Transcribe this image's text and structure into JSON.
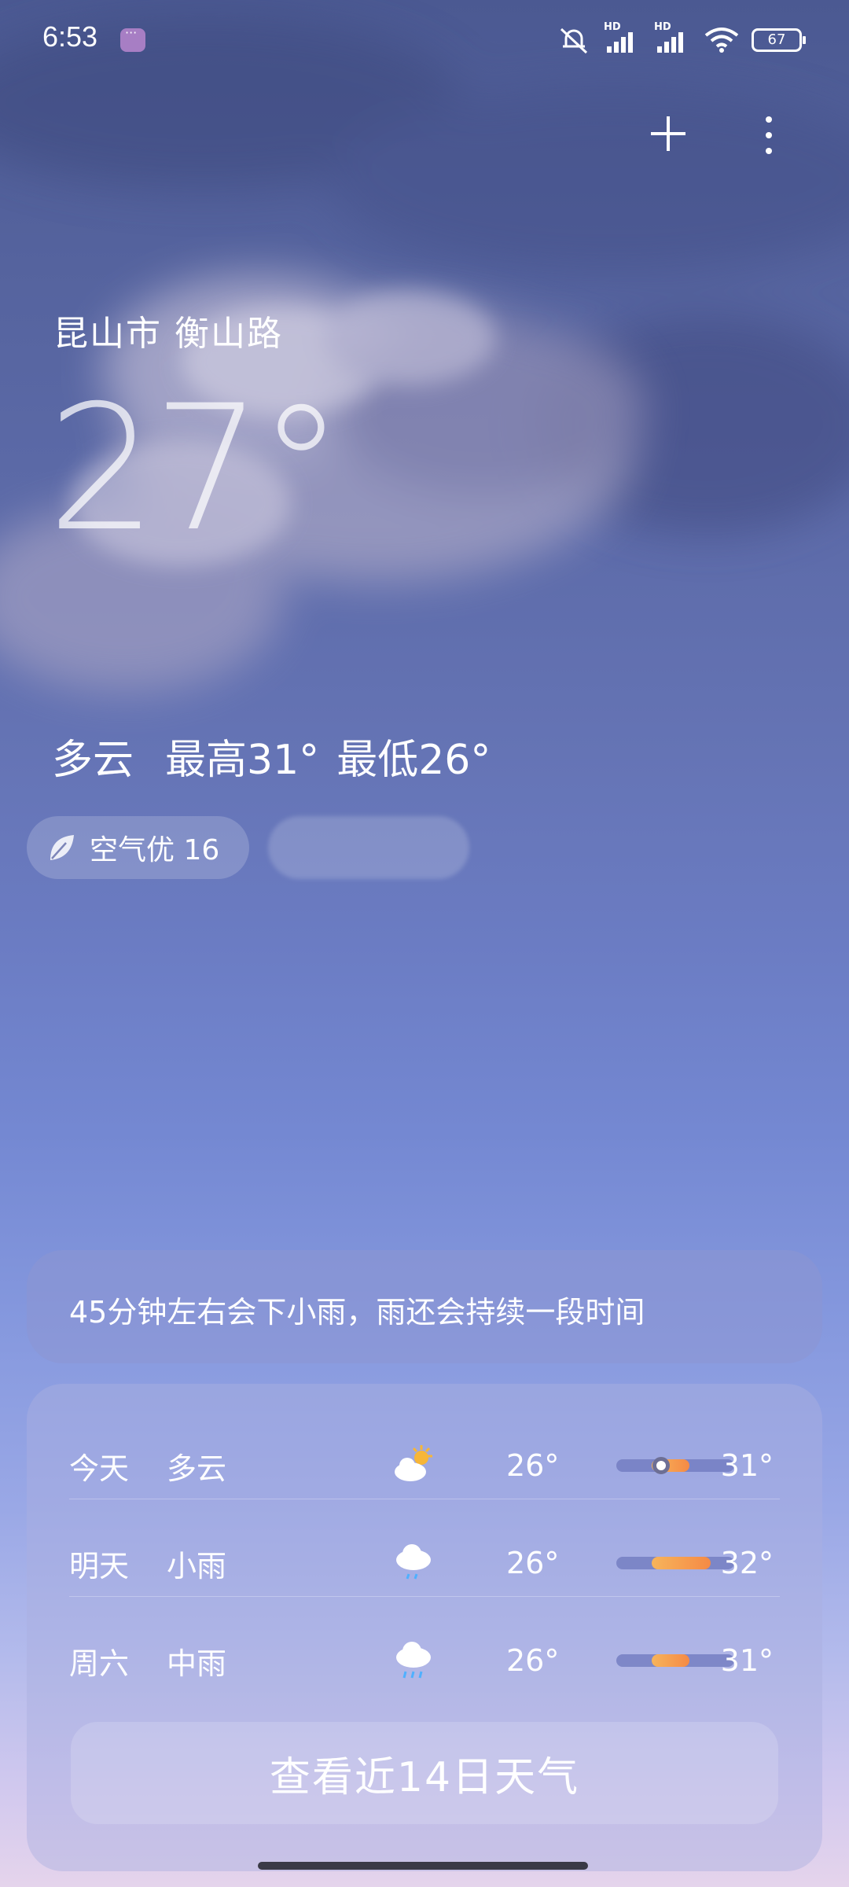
{
  "status_bar": {
    "time": "6:53",
    "signal_1_label": "HD",
    "signal_2_label": "HD",
    "battery": "67",
    "icons": [
      "chat-notification-icon",
      "silent-icon",
      "signal-icon",
      "wifi-icon",
      "battery-icon"
    ]
  },
  "header": {
    "add_icon": "plus-icon",
    "more_icon": "more-vertical-icon"
  },
  "current": {
    "location": "昆山市 衡山路",
    "temperature": "27°",
    "condition": "多云",
    "high": "最高31°",
    "low": "最低26°",
    "air_quality": "空气优 16"
  },
  "alert": {
    "text": "45分钟左右会下小雨，雨还会持续一段时间"
  },
  "forecast": {
    "days": [
      {
        "day": "今天",
        "condition": "多云",
        "icon": "partly-cloudy-icon",
        "low": "26°",
        "high": "31°",
        "bar_start": 0.3,
        "bar_end": 0.62,
        "current_marker": 0.38
      },
      {
        "day": "明天",
        "condition": "小雨",
        "icon": "light-rain-icon",
        "low": "26°",
        "high": "32°",
        "bar_start": 0.3,
        "bar_end": 0.8
      },
      {
        "day": "周六",
        "condition": "中雨",
        "icon": "moderate-rain-icon",
        "low": "26°",
        "high": "31°",
        "bar_start": 0.3,
        "bar_end": 0.62
      }
    ],
    "button_label": "查看近14日天气"
  },
  "colors": {
    "sky_top": "#4b5992",
    "sky_bottom": "#e5d4ec",
    "bar_fill": "#f58a45"
  }
}
